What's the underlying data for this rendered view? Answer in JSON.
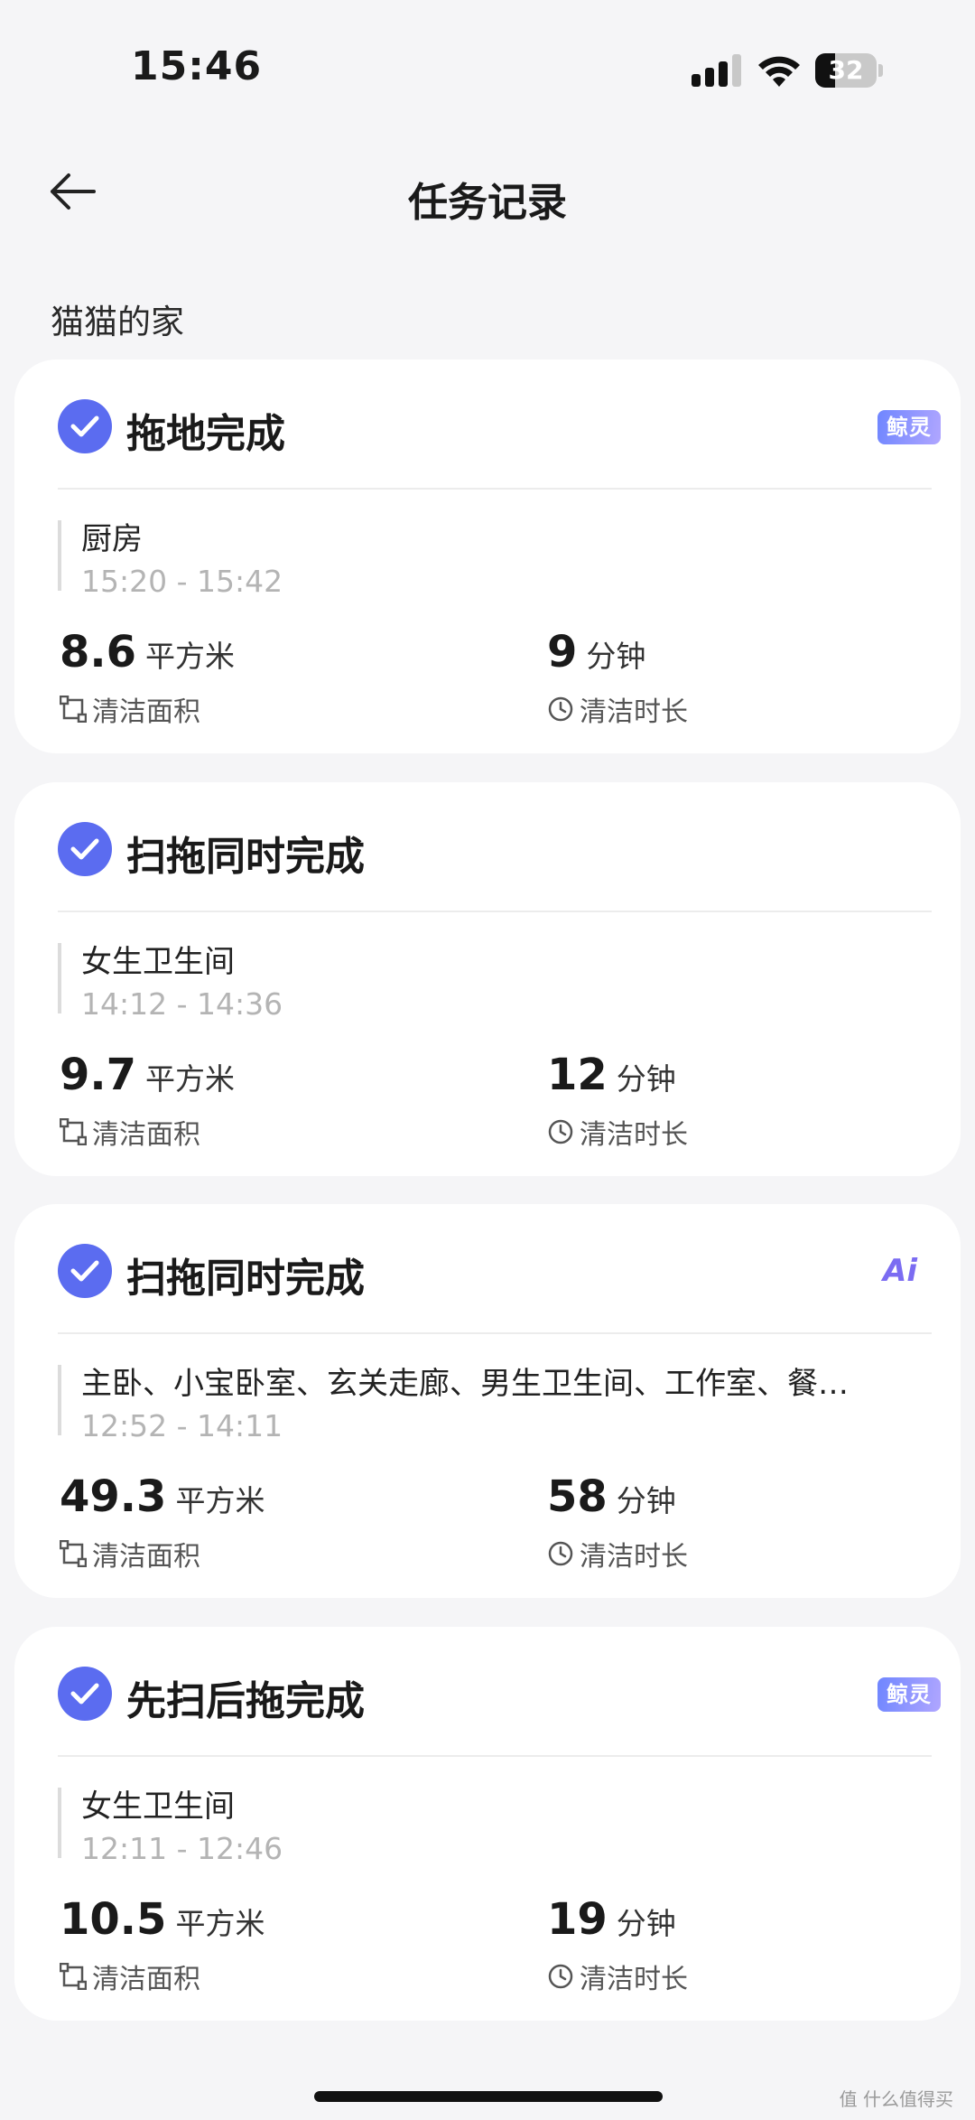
{
  "status_bar": {
    "time": "15:46",
    "battery": "32",
    "battery_level": 0.32
  },
  "header": {
    "title": "任务记录",
    "back_icon": "arrow-left-icon"
  },
  "home_name": "猫猫的家",
  "labels": {
    "area": "清洁面积",
    "duration": "清洁时长"
  },
  "records": [
    {
      "title": "拖地完成",
      "badge": "鲸灵",
      "room": "厨房",
      "time": "15:20 - 15:42",
      "area": "8.6",
      "area_unit": "平方米",
      "duration": "9",
      "duration_unit": "分钟"
    },
    {
      "title": "扫拖同时完成",
      "badge": "",
      "room": "女生卫生间",
      "time": "14:12 - 14:36",
      "area": "9.7",
      "area_unit": "平方米",
      "duration": "12",
      "duration_unit": "分钟"
    },
    {
      "title": "扫拖同时完成",
      "badge": "Ai",
      "room": "主卧、小宝卧室、玄关走廊、男生卫生间、工作室、餐…",
      "time": "12:52 - 14:11",
      "area": "49.3",
      "area_unit": "平方米",
      "duration": "58",
      "duration_unit": "分钟"
    },
    {
      "title": "先扫后拖完成",
      "badge": "鲸灵",
      "room": "女生卫生间",
      "time": "12:11 - 12:46",
      "area": "10.5",
      "area_unit": "平方米",
      "duration": "19",
      "duration_unit": "分钟"
    }
  ],
  "watermark": "值 什么值得买",
  "colors": {
    "accent": "#5b6cf0",
    "background": "#f5f5f7",
    "card": "#ffffff"
  }
}
